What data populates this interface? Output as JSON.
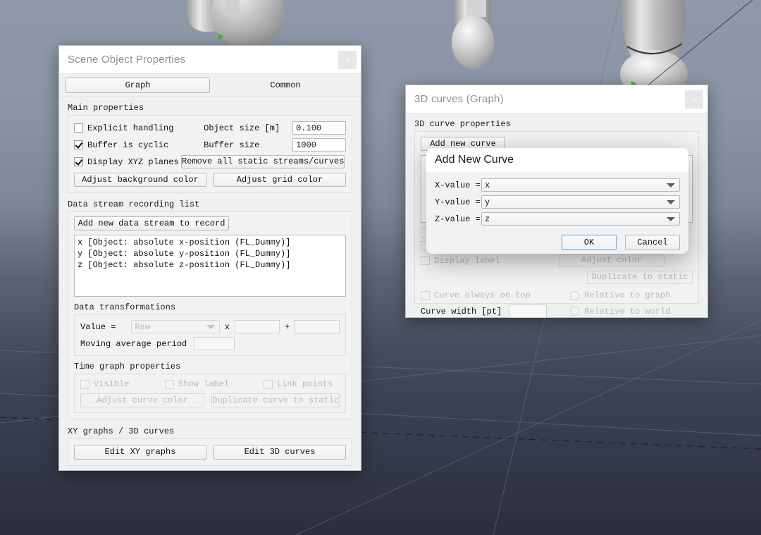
{
  "scene": {
    "name": "3d-simulation-viewport",
    "sky_color": "#8e98a8",
    "floor_color": "#2b2f3d",
    "grid_color": "#6e7380"
  },
  "properties_window": {
    "title": "Scene Object Properties",
    "close_glyph": "×",
    "tabs": [
      {
        "label": "Graph",
        "active": true
      },
      {
        "label": "Common",
        "active": false
      }
    ],
    "main_properties": {
      "section_label": "Main properties",
      "explicit_handling": {
        "label": "Explicit handling",
        "checked": false
      },
      "buffer_is_cyclic": {
        "label": "Buffer is cyclic",
        "checked": true
      },
      "display_xyz_planes": {
        "label": "Display XYZ planes",
        "checked": true
      },
      "object_size_label": "Object size [m]",
      "object_size_value": "0.100",
      "buffer_size_label": "Buffer size",
      "buffer_size_value": "1000",
      "remove_all_button": "Remove all static streams/curves",
      "adjust_background_button": "Adjust background color",
      "adjust_grid_button": "Adjust grid color"
    },
    "data_stream": {
      "section_label": "Data stream recording list",
      "add_button": "Add new data stream to record",
      "items": [
        "x [Object: absolute x-position (FL_Dummy)]",
        "y [Object: absolute y-position (FL_Dummy)]",
        "z [Object: absolute z-position (FL_Dummy)]"
      ]
    },
    "data_transformations": {
      "section_label": "Data transformations",
      "value_label": "Value =",
      "transform_selected": "Raw",
      "multiply_symbol": "x",
      "multiply_value": "",
      "plus_symbol": "+",
      "offset_value": "",
      "moving_average_label": "Moving average period",
      "moving_average_value": ""
    },
    "time_graph": {
      "section_label": "Time graph properties",
      "visible": {
        "label": "Visible",
        "checked": false
      },
      "show_label": {
        "label": "Show label",
        "checked": false
      },
      "link_points": {
        "label": "Link points",
        "checked": false
      },
      "adjust_curve_color_button": "Adjust curve color",
      "duplicate_curve_button": "Duplicate curve to static"
    },
    "graphs_section": {
      "section_label": "XY graphs / 3D curves",
      "edit_xy_button": "Edit XY graphs",
      "edit_3d_button": "Edit 3D curves"
    }
  },
  "curves_window": {
    "title": "3D curves (Graph)",
    "close_glyph": "×",
    "section_label": "3D curve properties",
    "add_new_curve_button": "Add new curve",
    "display_label": {
      "label": "Display label",
      "checked": false
    },
    "adjust_color_button": "Adjust color",
    "duplicate_to_static_button": "Duplicate to static",
    "curve_always_on_top": {
      "label": "Curve always on top",
      "checked": false
    },
    "curve_width_label": "Curve width [pt]",
    "curve_width_value": "",
    "relative_to_graph": "Relative to graph",
    "relative_to_world": "Relative to world"
  },
  "add_curve_modal": {
    "title": "Add New Curve",
    "x_label": "X-value =",
    "x_value": "x",
    "y_label": "Y-value =",
    "y_value": "y",
    "z_label": "Z-value =",
    "z_value": "z",
    "ok_button": "OK",
    "cancel_button": "Cancel",
    "accent_color": "#4ea3e0"
  }
}
